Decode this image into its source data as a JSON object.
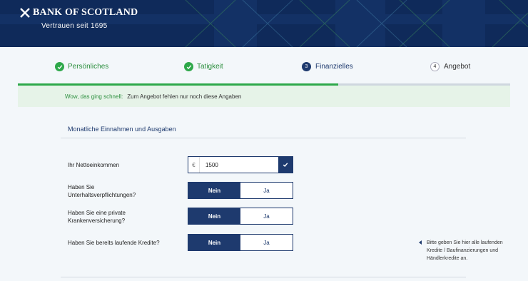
{
  "brand": {
    "name": "BANK OF SCOTLAND",
    "tagline": "Vertrauen seit 1695"
  },
  "steps": [
    {
      "label": "Persönliches",
      "state": "done"
    },
    {
      "label": "Tatigkeit",
      "state": "done"
    },
    {
      "number": "3",
      "label": "Finanzielles",
      "state": "active"
    },
    {
      "number": "4",
      "label": "Angebot",
      "state": "todo"
    }
  ],
  "progress": {
    "completed_fraction": 0.65
  },
  "banner": {
    "lead": "Wow, das ging schnell:",
    "text": "Zum Angebot fehlen nur noch diese Angaben"
  },
  "section": {
    "title": "Monatliche Einnahmen und Ausgaben"
  },
  "income": {
    "label": "Ihr Nettoeinkommen",
    "currency": "€",
    "value": "1500"
  },
  "questions": [
    {
      "label_line1": "Haben Sie",
      "label_line2": "Unterhaltsverpflichtungen?",
      "yes": "Ja",
      "no": "Nein",
      "selected": "Nein"
    },
    {
      "label_line1": "Haben Sie eine private",
      "label_line2": "Krankenversicherung?",
      "yes": "Ja",
      "no": "Nein",
      "selected": "Nein"
    },
    {
      "label_line1": "Haben Sie bereits laufende Kredite?",
      "label_line2": "",
      "yes": "Ja",
      "no": "Nein",
      "selected": "Nein"
    }
  ],
  "hint": {
    "text": "Bitte geben Sie hier alle laufenden Kredite / Baufinanzierungen und Händlerkredite an."
  },
  "colors": {
    "navy": "#1e3a6e",
    "header": "#0f2a5a",
    "green": "#2ea84a",
    "background": "#f3f7fa"
  }
}
